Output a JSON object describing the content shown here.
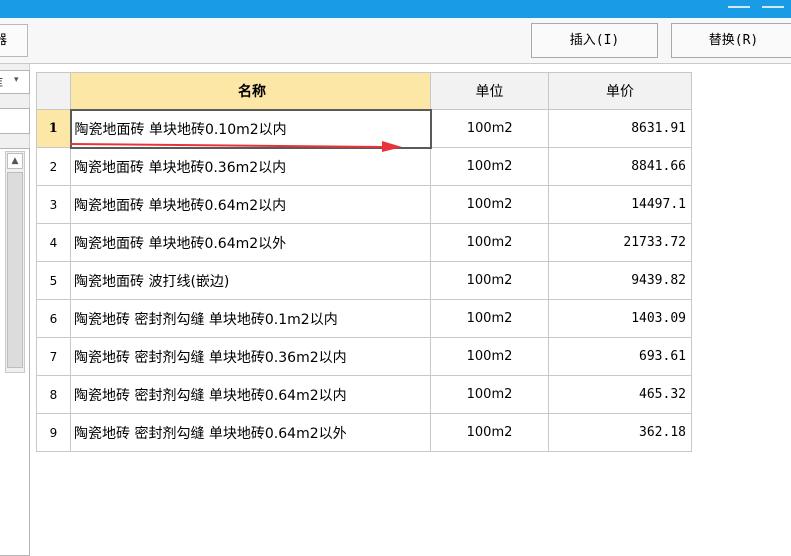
{
  "toolbar": {
    "left_label": "器",
    "insert_label": "插入(I)",
    "replace_label": "替换(R)"
  },
  "leftpane": {
    "combo_text": "库",
    "combo_arrow": "▾",
    "scroll_up": "▲"
  },
  "table": {
    "headers": {
      "index": "",
      "name": "名称",
      "unit": "单位",
      "price": "单价"
    },
    "rows": [
      {
        "index": "1",
        "name": "陶瓷地面砖 单块地砖0.10m2以内",
        "unit": "100m2",
        "price": "8631.91"
      },
      {
        "index": "2",
        "name": "陶瓷地面砖 单块地砖0.36m2以内",
        "unit": "100m2",
        "price": "8841.66"
      },
      {
        "index": "3",
        "name": "陶瓷地面砖 单块地砖0.64m2以内",
        "unit": "100m2",
        "price": "14497.1"
      },
      {
        "index": "4",
        "name": "陶瓷地面砖 单块地砖0.64m2以外",
        "unit": "100m2",
        "price": "21733.72"
      },
      {
        "index": "5",
        "name": "陶瓷地面砖 波打线(嵌边)",
        "unit": "100m2",
        "price": "9439.82"
      },
      {
        "index": "6",
        "name": "陶瓷地砖 密封剂勾缝 单块地砖0.1m2以内",
        "unit": "100m2",
        "price": "1403.09"
      },
      {
        "index": "7",
        "name": "陶瓷地砖 密封剂勾缝 单块地砖0.36m2以内",
        "unit": "100m2",
        "price": "693.61"
      },
      {
        "index": "8",
        "name": "陶瓷地砖 密封剂勾缝 单块地砖0.64m2以内",
        "unit": "100m2",
        "price": "465.32"
      },
      {
        "index": "9",
        "name": "陶瓷地砖 密封剂勾缝 单块地砖0.64m2以外",
        "unit": "100m2",
        "price": "362.18"
      }
    ]
  },
  "colors": {
    "accent": "#1a9be6",
    "header_highlight": "#fde7a7",
    "arrow": "#e8333a"
  },
  "icons": {
    "annotation": "red-arrow-icon"
  }
}
